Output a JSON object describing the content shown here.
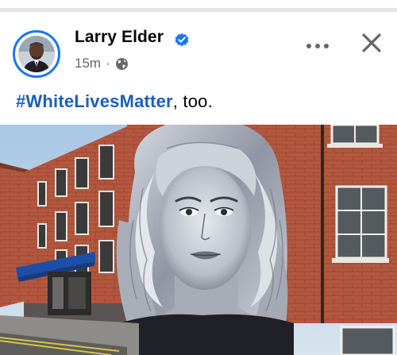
{
  "post": {
    "author": "Larry Elder",
    "time": "15m",
    "separator": "·",
    "audience_icon": "globe-icon",
    "verified_icon": "verified-badge-icon",
    "text_hashtag": "#WhiteLivesMatter",
    "text_rest": ", too.",
    "image": {
      "description": "mural-on-brick-building"
    }
  },
  "actions": {
    "more_icon": "more-options-icon",
    "close_icon": "close-icon"
  },
  "colors": {
    "verified": "#1877f2",
    "hashtag": "#1b5fbd",
    "meta": "#65676b",
    "brick": "#b2553d"
  }
}
